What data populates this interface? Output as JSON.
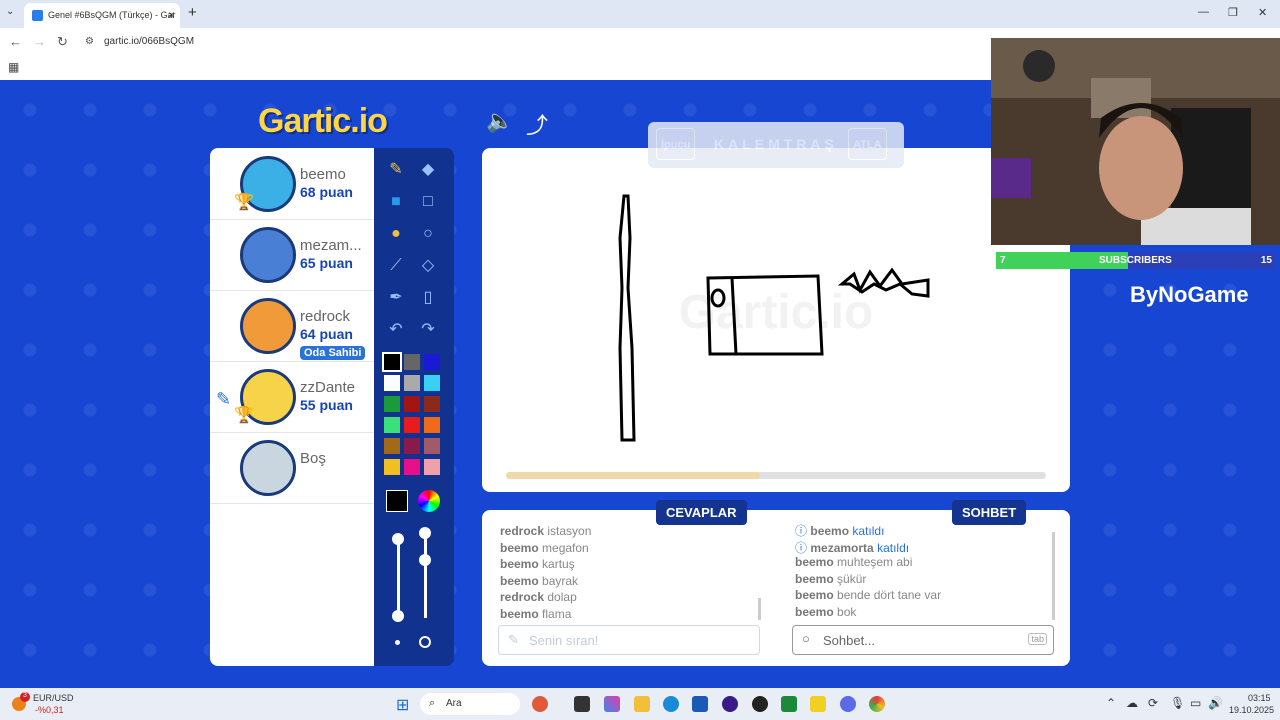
{
  "browser": {
    "tab_title": "Genel #6BsQGM (Türkçe) - Gar",
    "url": "gartic.io/066BsQGM",
    "win_minimize": "—",
    "win_restore": "❐",
    "win_close": "✕"
  },
  "game": {
    "logo": "Gartic.io",
    "players": [
      {
        "name": "beemo",
        "points": "68 puan",
        "color": "#3ab0e6",
        "trophy": true,
        "host": false,
        "drawing": false
      },
      {
        "name": "mezam...",
        "points": "65 puan",
        "color": "#4a7fd6",
        "trophy": false,
        "host": false,
        "drawing": false
      },
      {
        "name": "redrock",
        "points": "64 puan",
        "color": "#f09a3a",
        "trophy": false,
        "host": true,
        "host_label": "Oda Sahibi",
        "drawing": false
      },
      {
        "name": "zzDante",
        "points": "55 puan",
        "color": "#f7d34a",
        "trophy": true,
        "host": false,
        "drawing": true
      },
      {
        "name": "Boş",
        "points": "",
        "color": "#c9d6e0",
        "trophy": false,
        "host": false,
        "drawing": false
      }
    ],
    "hint_button": "İpucu",
    "hint_word": "KALEMTRAŞ",
    "skip_button": "ATLA",
    "timer_progress": 0.47,
    "palette": [
      "#000000",
      "#666666",
      "#1a1ad6",
      "#ffffff",
      "#aaaaaa",
      "#3ad0f0",
      "#1a9a3a",
      "#a31515",
      "#8b2a1a",
      "#3ae07a",
      "#e81c1c",
      "#f06a1a",
      "#a06a1a",
      "#8a1a4a",
      "#a05a6a",
      "#f0c020",
      "#e8108a",
      "#f0a0a8"
    ],
    "answers_title": "CEVAPLAR",
    "answers": [
      {
        "user": "redrock",
        "text": "istasyon"
      },
      {
        "user": "beemo",
        "text": "megafon"
      },
      {
        "user": "beemo",
        "text": "kartuş"
      },
      {
        "user": "beemo",
        "text": "bayrak"
      },
      {
        "user": "redrock",
        "text": "dolap"
      },
      {
        "user": "beemo",
        "text": "flama"
      }
    ],
    "answers_placeholder": "Senin sıran!",
    "chat_title": "SOHBET",
    "chat": [
      {
        "user": "beemo",
        "text": "katıldı",
        "system": true
      },
      {
        "user": "mezamorta",
        "text": "katıldı",
        "system": true
      },
      {
        "user": "beemo",
        "text": "muhteşem abi",
        "system": false
      },
      {
        "user": "beemo",
        "text": "şükür",
        "system": false
      },
      {
        "user": "beemo",
        "text": "bende dört tane var",
        "system": false
      },
      {
        "user": "beemo",
        "text": "bok",
        "system": false
      }
    ],
    "chat_placeholder": "Sohbet...",
    "chat_tab_hint": "tab"
  },
  "overlay": {
    "subs_current": "7",
    "subs_label": "SUBSCRIBERS",
    "subs_goal": "15",
    "subs_progress": 0.47,
    "brand": "ByNoGame"
  },
  "taskbar": {
    "ticker": "EUR/USD",
    "ticker_change": "-%0,31",
    "badge_count": "3",
    "search": "Ara",
    "time": "03:15",
    "date": "19.10.2025"
  }
}
